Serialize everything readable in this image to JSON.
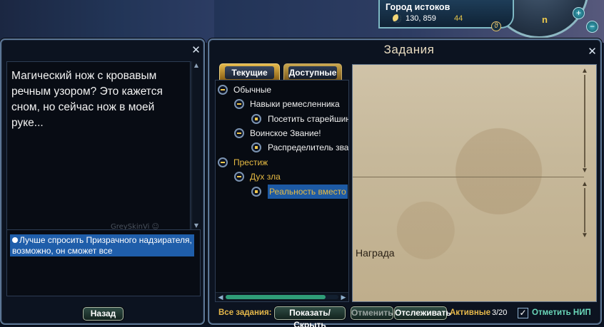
{
  "minimap": {
    "location": "Город истоков",
    "coords": "130, 859",
    "level": "44",
    "north_marker": "n",
    "south_marker": "ϑ",
    "zoom_in_label": "+",
    "zoom_out_label": "−"
  },
  "dialog": {
    "close_label": "✕",
    "text": "Магический нож с кровавым речным узором? Это кажется сном, но сейчас нож в моей руке...",
    "watermark": "GreySkinVi ☺",
    "options": [
      "Лучше спросить Призрачного надзирателя, возможно, он сможет все"
    ],
    "back_label": "Назад"
  },
  "quest": {
    "title": "Задания",
    "close_label": "✕",
    "tabs": [
      "Текущие",
      "Доступные"
    ],
    "list": {
      "group_normal": "Обычные",
      "sub_crafting": "Навыки ремесленника",
      "quest_elder": "Посетить старейшин",
      "sub_military": "Воинское Звание!",
      "quest_distributor": "Распределитель зва",
      "group_prestige": "Престиж",
      "sub_evil_spirit": "Дух зла",
      "quest_reality": "Реальность вместо"
    },
    "reward_label": "Награда",
    "bottom": {
      "all_quests_label": "Все задания:",
      "show_hide_label": "Показать/Скрыть",
      "cancel_label": "Отменить",
      "track_label": "Отслеживать",
      "active_label": "Активные",
      "active_count": "3/20",
      "mark_npc_label": "Отметить НИП",
      "mark_npc_checked": true
    }
  },
  "colors": {
    "accent_gold": "#e6b84a",
    "selection_blue": "#1d5aa4",
    "frame_border": "#5c7695",
    "parchment": "#c6b89a"
  }
}
